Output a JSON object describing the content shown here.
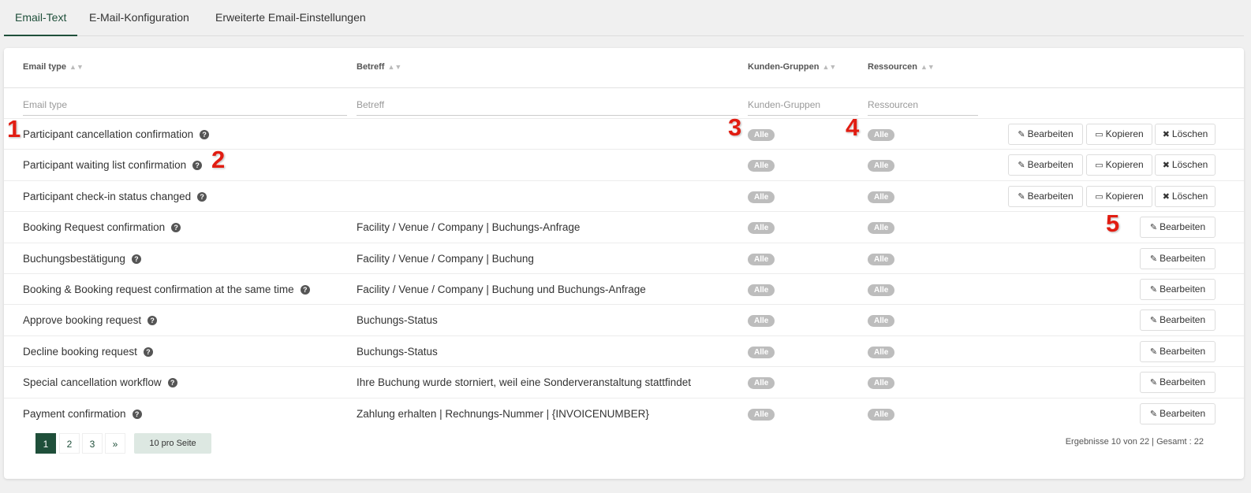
{
  "tabs": [
    {
      "label": "Email-Text",
      "active": true
    },
    {
      "label": "E-Mail-Konfiguration",
      "active": false
    },
    {
      "label": "Erweiterte Email-Einstellungen",
      "active": false
    }
  ],
  "columns": {
    "email_type": "Email type",
    "betreff": "Betreff",
    "kunden": "Kunden-Gruppen",
    "ressourcen": "Ressourcen"
  },
  "filters": {
    "email_type": "Email type",
    "betreff": "Betreff",
    "kunden": "Kunden-Gruppen",
    "ressourcen": "Ressourcen"
  },
  "buttons": {
    "edit": "Bearbeiten",
    "copy": "Kopieren",
    "delete": "Löschen"
  },
  "rows": [
    {
      "type": "Participant cancellation confirmation",
      "subject": "",
      "groups": "Alle",
      "resources": "Alle",
      "actions": "full"
    },
    {
      "type": "Participant waiting list confirmation",
      "subject": "",
      "groups": "Alle",
      "resources": "Alle",
      "actions": "full"
    },
    {
      "type": "Participant check-in status changed",
      "subject": "",
      "groups": "Alle",
      "resources": "Alle",
      "actions": "full"
    },
    {
      "type": "Booking Request confirmation",
      "subject": "Facility / Venue / Company | Buchungs-Anfrage",
      "groups": "Alle",
      "resources": "Alle",
      "actions": "edit"
    },
    {
      "type": "Buchungsbestätigung",
      "subject": "Facility / Venue / Company | Buchung",
      "groups": "Alle",
      "resources": "Alle",
      "actions": "edit"
    },
    {
      "type": "Booking & Booking request confirmation at the same time",
      "subject": "Facility / Venue / Company | Buchung und Buchungs-Anfrage",
      "groups": "Alle",
      "resources": "Alle",
      "actions": "edit"
    },
    {
      "type": "Approve booking request",
      "subject": "Buchungs-Status",
      "groups": "Alle",
      "resources": "Alle",
      "actions": "edit"
    },
    {
      "type": "Decline booking request",
      "subject": "Buchungs-Status",
      "groups": "Alle",
      "resources": "Alle",
      "actions": "edit"
    },
    {
      "type": "Special cancellation workflow",
      "subject": "Ihre Buchung wurde storniert, weil eine Sonderveranstaltung stattfindet",
      "groups": "Alle",
      "resources": "Alle",
      "actions": "edit"
    },
    {
      "type": "Payment confirmation",
      "subject": "Zahlung erhalten | Rechnungs-Nummer | {INVOICENUMBER}",
      "groups": "Alle",
      "resources": "Alle",
      "actions": "edit"
    }
  ],
  "markers": [
    "1",
    "2",
    "3",
    "4",
    "5"
  ],
  "pagination": {
    "pages": [
      "1",
      "2",
      "3"
    ],
    "active": "1",
    "next": "»",
    "per_page": "10 pro Seite",
    "summary": "Ergebnisse 10 von 22 | Gesamt : 22"
  },
  "icons": {
    "help": "question-circle-icon",
    "edit": "edit-icon",
    "copy": "window-icon",
    "delete": "times-icon",
    "sort": "sort-icon"
  },
  "colors": {
    "accent": "#1f4f3a",
    "badge": "#bdbdbd",
    "marker": "#e11d12"
  }
}
